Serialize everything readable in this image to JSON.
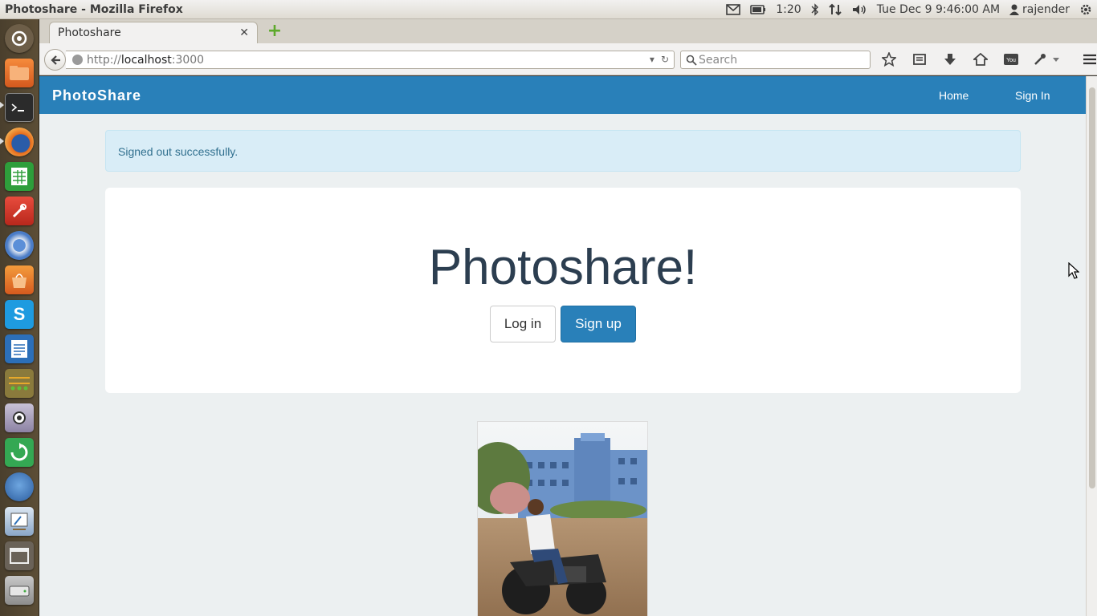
{
  "os": {
    "window_title": "Photoshare - Mozilla Firefox",
    "battery": "1:20",
    "datetime": "Tue Dec  9  9:46:00 AM",
    "user": "rajender"
  },
  "launcher": {
    "apps": [
      "dash-home-icon",
      "files-icon",
      "terminal-icon",
      "firefox-icon",
      "spreadsheet-icon",
      "system-settings-icon",
      "chromium-icon",
      "software-center-icon",
      "skype-icon",
      "writer-icon",
      "workspaces-icon",
      "webcam-icon",
      "update-manager-icon",
      "gimp-icon",
      "draw-icon",
      "window-icon",
      "drive-icon"
    ]
  },
  "browser": {
    "tab_title": "Photoshare",
    "url_prefix": "http://",
    "url_host": "localhost",
    "url_port": ":3000",
    "search_placeholder": "Search"
  },
  "page": {
    "brand": "PhotoShare",
    "nav_home": "Home",
    "nav_signin": "Sign In",
    "alert": "Signed out successfully.",
    "heading": "Photoshare!",
    "login_label": "Log in",
    "signup_label": "Sign up",
    "colors": {
      "nav": "#2980b9",
      "alert_bg": "#d9edf7",
      "page_bg": "#ecf0f1"
    }
  }
}
